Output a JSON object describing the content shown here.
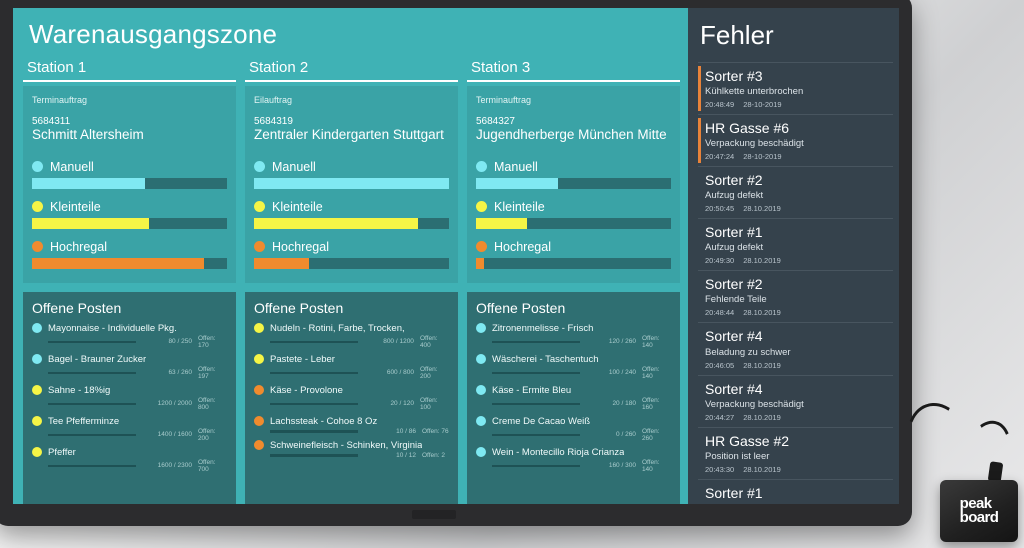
{
  "header": {
    "main_title": "Warenausgangszone",
    "errors_title": "Fehler"
  },
  "colors": {
    "teal_bg": "#3fb2b5",
    "card_bg": "#3aa3a6",
    "posten_bg": "#2f6f72",
    "dark_bg": "#35424c",
    "accent_orange": "#e8833a",
    "manuell": "#7fe9f2",
    "kleinteile": "#f5f546",
    "hochregal": "#f08b2e"
  },
  "stations": [
    {
      "title": "Station 1",
      "order_type": "Terminauftrag",
      "order_no": "5684311",
      "order_name": "Schmitt Altersheim",
      "bars": [
        {
          "label": "Manuell",
          "color": "#7fe9f2",
          "percent": 58
        },
        {
          "label": "Kleinteile",
          "color": "#f5f546",
          "percent": 60
        },
        {
          "label": "Hochregal",
          "color": "#f08b2e",
          "percent": 88
        }
      ],
      "posten_title": "Offene Posten",
      "posten": [
        {
          "name": "Mayonnaise - Individuelle Pkg.",
          "color": "#7fe9f2",
          "numbers": "80 / 250",
          "open": "Offen: 170",
          "percent": 32
        },
        {
          "name": "Bagel - Brauner Zucker",
          "color": "#7fe9f2",
          "numbers": "63 / 260",
          "open": "Offen: 197",
          "percent": 24
        },
        {
          "name": "Sahne - 18%ig",
          "color": "#f5f546",
          "numbers": "1200 / 2000",
          "open": "Offen: 800",
          "percent": 60
        },
        {
          "name": "Tee Pfefferminze",
          "color": "#f5f546",
          "numbers": "1400 / 1600",
          "open": "Offen: 200",
          "percent": 87
        },
        {
          "name": "Pfeffer",
          "color": "#f5f546",
          "numbers": "1600 / 2300",
          "open": "Offen: 700",
          "percent": 70
        }
      ]
    },
    {
      "title": "Station 2",
      "order_type": "Eilauftrag",
      "order_no": "5684319",
      "order_name": "Zentraler Kindergarten Stuttgart",
      "bars": [
        {
          "label": "Manuell",
          "color": "#7fe9f2",
          "percent": 100
        },
        {
          "label": "Kleinteile",
          "color": "#f5f546",
          "percent": 84
        },
        {
          "label": "Hochregal",
          "color": "#f08b2e",
          "percent": 28
        }
      ],
      "posten_title": "Offene Posten",
      "posten": [
        {
          "name": "Nudeln - Rotini, Farbe, Trocken,",
          "color": "#f5f546",
          "numbers": "800 / 1200",
          "open": "Offen: 400",
          "percent": 67
        },
        {
          "name": "Pastete - Leber",
          "color": "#f5f546",
          "numbers": "600 / 800",
          "open": "Offen: 200",
          "percent": 75
        },
        {
          "name": "Käse - Provolone",
          "color": "#f08b2e",
          "numbers": "20 / 120",
          "open": "Offen: 100",
          "percent": 17
        },
        {
          "name": "Lachssteak - Cohoe 8 Oz",
          "color": "#f08b2e",
          "numbers": "10 / 86",
          "open": "Offen: 76",
          "percent": 12
        },
        {
          "name": "Schweinefleisch - Schinken, Virginia",
          "color": "#f08b2e",
          "numbers": "10 / 12",
          "open": "Offen: 2",
          "percent": 83
        }
      ]
    },
    {
      "title": "Station 3",
      "order_type": "Terminauftrag",
      "order_no": "5684327",
      "order_name": "Jugendherberge München Mitte",
      "bars": [
        {
          "label": "Manuell",
          "color": "#7fe9f2",
          "percent": 42
        },
        {
          "label": "Kleinteile",
          "color": "#f5f546",
          "percent": 26
        },
        {
          "label": "Hochregal",
          "color": "#f08b2e",
          "percent": 4
        }
      ],
      "posten_title": "Offene Posten",
      "posten": [
        {
          "name": "Zitronenmelisse - Frisch",
          "color": "#7fe9f2",
          "numbers": "120 / 260",
          "open": "Offen: 140",
          "percent": 46
        },
        {
          "name": "Wäscherei - Taschentuch",
          "color": "#7fe9f2",
          "numbers": "100 / 240",
          "open": "Offen: 140",
          "percent": 42
        },
        {
          "name": "Käse - Ermite Bleu",
          "color": "#7fe9f2",
          "numbers": "20 / 180",
          "open": "Offen: 160",
          "percent": 11
        },
        {
          "name": "Creme De Cacao Weiß",
          "color": "#7fe9f2",
          "numbers": "0 / 260",
          "open": "Offen: 260",
          "percent": 0
        },
        {
          "name": "Wein - Montecillo Rioja Crianza",
          "color": "#7fe9f2",
          "numbers": "160 / 300",
          "open": "Offen: 140",
          "percent": 53
        }
      ]
    }
  ],
  "errors": [
    {
      "title": "Sorter #3",
      "desc": "Kühlkette unterbrochen",
      "time": "20:48:49",
      "date": "28-10-2019",
      "accent": true
    },
    {
      "title": "HR Gasse #6",
      "desc": "Verpackung beschädigt",
      "time": "20:47:24",
      "date": "28-10-2019",
      "accent": true
    },
    {
      "title": "Sorter #2",
      "desc": "Aufzug defekt",
      "time": "20:50:45",
      "date": "28.10.2019",
      "accent": false
    },
    {
      "title": "Sorter #1",
      "desc": "Aufzug defekt",
      "time": "20:49:30",
      "date": "28.10.2019",
      "accent": false
    },
    {
      "title": "Sorter #2",
      "desc": "Fehlende Teile",
      "time": "20:48:44",
      "date": "28.10.2019",
      "accent": false
    },
    {
      "title": "Sorter #4",
      "desc": "Beladung zu schwer",
      "time": "20:46:05",
      "date": "28.10.2019",
      "accent": false
    },
    {
      "title": "Sorter #4",
      "desc": "Verpackung beschädigt",
      "time": "20:44:27",
      "date": "28.10.2019",
      "accent": false
    },
    {
      "title": "HR Gasse #2",
      "desc": "Position ist leer",
      "time": "20:43:30",
      "date": "28.10.2019",
      "accent": false
    },
    {
      "title": "Sorter #1",
      "desc": "",
      "time": "",
      "date": "",
      "accent": false
    }
  ],
  "device": {
    "logo_line1": "peak",
    "logo_line2": "board"
  }
}
